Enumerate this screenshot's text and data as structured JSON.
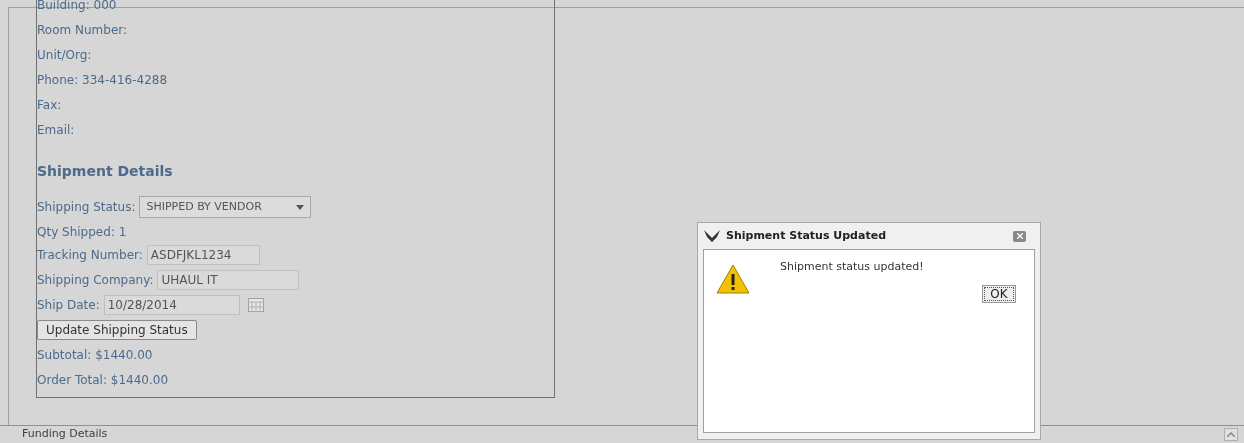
{
  "contact": [
    {
      "text": "Building: 000"
    },
    {
      "text": "Room Number:"
    },
    {
      "text": "Unit/Org:"
    },
    {
      "text": "Phone: 334-416-4288"
    },
    {
      "text": "Fax:"
    },
    {
      "text": "Email:"
    }
  ],
  "shipment": {
    "heading": "Shipment Details",
    "status_label": "Shipping Status:",
    "status_value": "SHIPPED BY VENDOR",
    "qty": "Qty Shipped: 1",
    "tracking_label": "Tracking Number:",
    "tracking_value": "ASDFJKL1234",
    "company_label": "Shipping Company:",
    "company_value": "UHAUL IT",
    "date_label": "Ship Date:",
    "date_value": "10/28/2014",
    "button": "Update Shipping Status",
    "subtotal": "Subtotal: $1440.00",
    "total": "Order Total: $1440.00"
  },
  "footer": {
    "title": "Funding Details"
  },
  "dialog": {
    "title": "Shipment Status Updated",
    "message": "Shipment status updated!",
    "button": "OK"
  }
}
